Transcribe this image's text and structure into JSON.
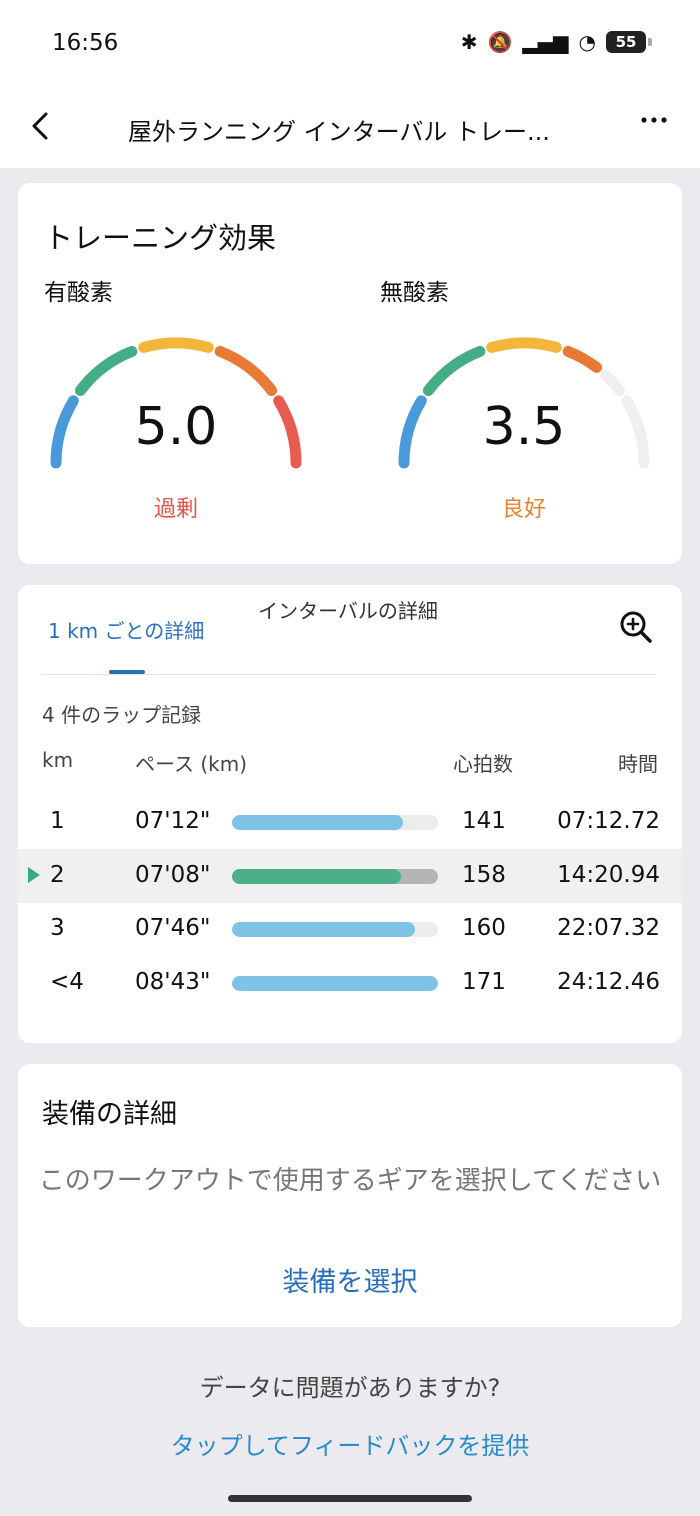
{
  "status_bar": {
    "time": "16:56",
    "icons": [
      "bluetooth-icon",
      "mute-icon",
      "signal-icon",
      "wifi-icon"
    ],
    "battery": "55"
  },
  "header": {
    "title": "屋外ランニング インターバル トレー...",
    "back_icon": "back-arrow-icon",
    "more_icon": "more-icon"
  },
  "training_effect": {
    "title": "トレーニング効果",
    "aerobic": {
      "label": "有酸素",
      "value": "5.0",
      "status": "過剰",
      "status_color": "#e0564b",
      "level": 5.0
    },
    "anaerobic": {
      "label": "無酸素",
      "value": "3.5",
      "status": "良好",
      "status_color": "#e8822c",
      "level": 3.5
    }
  },
  "laps": {
    "tabs": [
      "1 km ごとの詳細",
      "インターバルの詳細"
    ],
    "active_tab": 0,
    "count_text": "4 件のラップ記録",
    "columns": {
      "km": "km",
      "pace": "ペース (km)",
      "hr": "心拍数",
      "time": "時間"
    },
    "rows": [
      {
        "km": "1",
        "pace": "07'12\"",
        "hr": "141",
        "time": "07:12.72",
        "fill": 0.83,
        "color": "#7ec3e6",
        "highlight": false
      },
      {
        "km": "2",
        "pace": "07'08\"",
        "hr": "158",
        "time": "14:20.94",
        "fill": 0.82,
        "color": "#4caf88",
        "highlight": true
      },
      {
        "km": "3",
        "pace": "07'46\"",
        "hr": "160",
        "time": "22:07.32",
        "fill": 0.89,
        "color": "#7ec3e6",
        "highlight": false
      },
      {
        "km": "<4",
        "pace": "08'43\"",
        "hr": "171",
        "time": "24:12.46",
        "fill": 1.0,
        "color": "#7ec3e6",
        "highlight": false
      }
    ]
  },
  "gear": {
    "title": "装備の詳細",
    "description": "このワークアウトで使用するギアを選択してください",
    "select_label": "装備を選択"
  },
  "feedback": {
    "question": "データに問題がありますか?",
    "link": "タップしてフィードバックを提供"
  },
  "colors": {
    "accent": "#2a6fbb",
    "gauge_blue": "#4a9ad9",
    "gauge_green": "#44ad86",
    "gauge_yellow": "#f1b63a",
    "gauge_orange": "#e87a35",
    "gauge_red": "#e85b50"
  }
}
